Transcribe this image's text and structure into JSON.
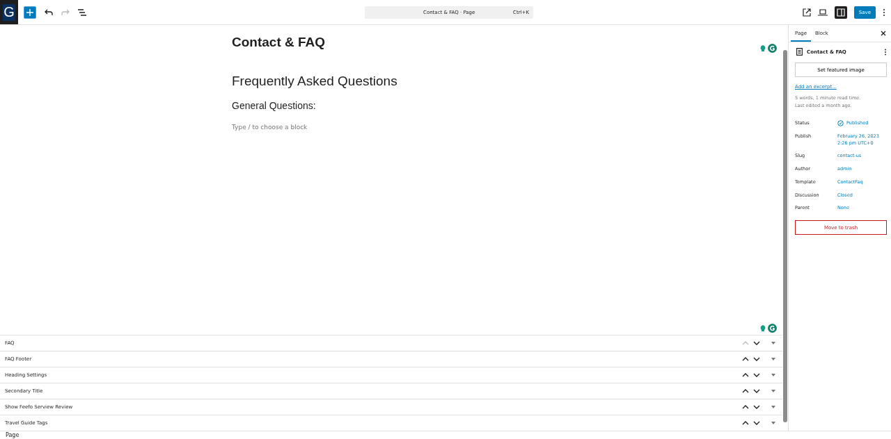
{
  "toolbar": {
    "logo": "G",
    "command_bar": {
      "title": "Contact & FAQ · Page",
      "shortcut": "Ctrl+K"
    },
    "redo_disabled": true,
    "settings_on": true,
    "save": "Save"
  },
  "editor": {
    "title": "Contact & FAQ",
    "blocks": [
      {
        "kind": "h2",
        "text": "Frequently Asked Questions"
      },
      {
        "kind": "h3",
        "text": "General Questions:"
      },
      {
        "kind": "placeholder",
        "text": "Type / to choose a block"
      }
    ]
  },
  "meta_boxes": [
    {
      "title": "FAQ",
      "up_disabled": true
    },
    {
      "title": "FAQ Footer",
      "up_disabled": false
    },
    {
      "title": "Heading Settings",
      "up_disabled": false
    },
    {
      "title": "Secondary Title",
      "up_disabled": false
    },
    {
      "title": "Show Feefo Serview Review",
      "up_disabled": false
    },
    {
      "title": "Travel Guide Tags",
      "up_disabled": false
    }
  ],
  "footer": {
    "breadcrumb": "Page"
  },
  "sidebar": {
    "tabs": [
      {
        "label": "Page",
        "selected": true
      },
      {
        "label": "Block",
        "selected": false
      }
    ],
    "document_title": "Contact & FAQ",
    "featured_image_button": "Set featured image",
    "excerpt_link": "Add an excerpt...",
    "stats": [
      "5 words, 1 minute read time.",
      "Last edited a month ago."
    ],
    "fields": [
      {
        "label": "Status",
        "lines": [
          "Published"
        ],
        "kind": "status"
      },
      {
        "label": "Publish",
        "lines": [
          "February 26, 2023",
          "2:26 pm UTC+0"
        ],
        "kind": "link"
      },
      {
        "label": "Slug",
        "lines": [
          "contact-us"
        ],
        "kind": "link"
      },
      {
        "label": "Author",
        "lines": [
          "admin"
        ],
        "kind": "link"
      },
      {
        "label": "Template",
        "lines": [
          "ContactFaq"
        ],
        "kind": "link"
      },
      {
        "label": "Discussion",
        "lines": [
          "Closed"
        ],
        "kind": "link"
      },
      {
        "label": "Parent",
        "lines": [
          "None"
        ],
        "kind": "link"
      }
    ],
    "trash_button": "Move to trash"
  }
}
